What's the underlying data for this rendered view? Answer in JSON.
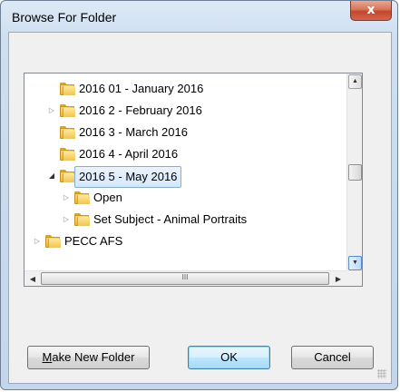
{
  "window": {
    "title": "Browse For Folder",
    "close_glyph": "x"
  },
  "tree": {
    "items": [
      {
        "label": "2016 01 - January 2016",
        "level": 1,
        "expander": "none",
        "selected": false
      },
      {
        "label": "2016 2 - February 2016",
        "level": 1,
        "expander": "collapsed",
        "selected": false
      },
      {
        "label": "2016 3 - March 2016",
        "level": 1,
        "expander": "none",
        "selected": false
      },
      {
        "label": "2016 4 - April 2016",
        "level": 1,
        "expander": "none",
        "selected": false
      },
      {
        "label": "2016 5 - May 2016",
        "level": 1,
        "expander": "expanded",
        "selected": true
      },
      {
        "label": "Open",
        "level": 2,
        "expander": "collapsed",
        "selected": false
      },
      {
        "label": "Set Subject - Animal Portraits",
        "level": 2,
        "expander": "collapsed",
        "selected": false
      },
      {
        "label": "PECC AFS",
        "level": 0,
        "expander": "collapsed",
        "selected": false
      }
    ],
    "icons": {
      "folder": "folder-icon",
      "collapsed": "▷",
      "expanded": "◢"
    },
    "vscroll": {
      "up": "▲",
      "down": "▼"
    },
    "hscroll": {
      "left": "◀",
      "right": "▶",
      "grip": "III"
    }
  },
  "buttons": {
    "make_new_folder_prefix": "M",
    "make_new_folder_rest": "ake New Folder",
    "ok": "OK",
    "cancel": "Cancel"
  }
}
